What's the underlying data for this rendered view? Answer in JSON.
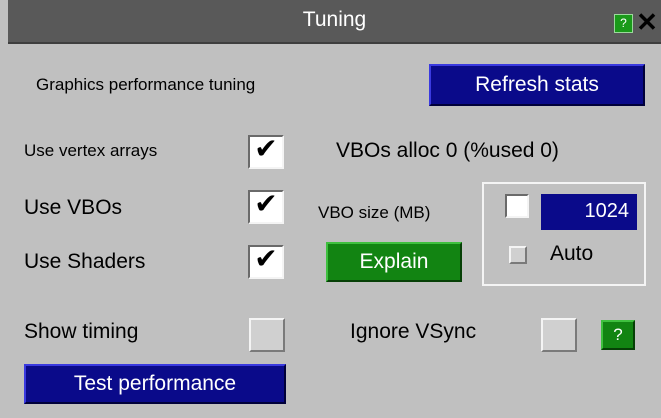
{
  "window": {
    "title": "Tuning",
    "help_label": "?",
    "close_label": "✕"
  },
  "header": {
    "label": "Graphics performance tuning",
    "refresh_label": "Refresh stats"
  },
  "options": {
    "vertex_arrays": {
      "label": "Use vertex arrays",
      "checked": true,
      "mark": "✔"
    },
    "vbos": {
      "label": "Use VBOs",
      "checked": true,
      "mark": "✔"
    },
    "shaders": {
      "label": "Use Shaders",
      "checked": true,
      "mark": "✔"
    },
    "show_timing": {
      "label": "Show timing",
      "checked": false
    }
  },
  "vbo": {
    "alloc_text": "VBOs alloc 0 (%used 0)",
    "size_label": "VBO size (MB)",
    "size_value": "1024",
    "size_enabled": false,
    "auto_label": "Auto",
    "auto_checked": false,
    "explain_label": "Explain"
  },
  "vsync": {
    "label": "Ignore VSync",
    "checked": false,
    "help_label": "?"
  },
  "footer": {
    "test_label": "Test performance"
  },
  "colors": {
    "button_blue": "#0a0a8a",
    "button_green": "#128412",
    "panel": "#c0c0c0",
    "titlebar": "#595959"
  }
}
